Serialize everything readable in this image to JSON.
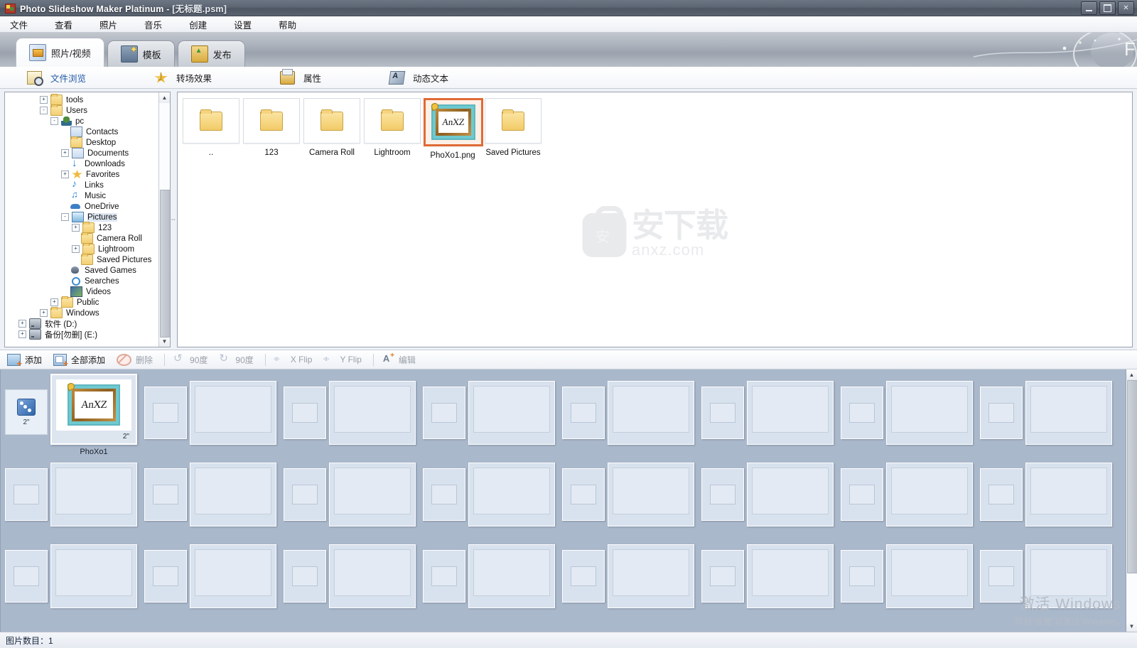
{
  "window": {
    "title_app": "Photo Slideshow Maker Platinum",
    "title_sep": " - ",
    "title_doc": "[无标题.psm]",
    "controls": {
      "minimize": "–",
      "maximize": "□",
      "close": "✕"
    }
  },
  "menu": {
    "items": [
      "文件",
      "查看",
      "照片",
      "音乐",
      "创建",
      "设置",
      "帮助"
    ]
  },
  "tabs": [
    {
      "label": "照片/视频",
      "icon": "photo-video-icon",
      "active": true
    },
    {
      "label": "模板",
      "icon": "template-icon",
      "active": false
    },
    {
      "label": "发布",
      "icon": "publish-icon",
      "active": false
    }
  ],
  "subtoolbar": [
    {
      "label": "文件浏览",
      "icon": "file-browse-icon",
      "active": true
    },
    {
      "label": "转场效果",
      "icon": "transition-star-icon",
      "active": false
    },
    {
      "label": "属性",
      "icon": "properties-icon",
      "active": false
    },
    {
      "label": "动态文本",
      "icon": "dynamic-text-icon",
      "active": false
    }
  ],
  "tree": {
    "nodes": [
      {
        "label": "tools",
        "indent": 3,
        "expander": "+",
        "icon": "folder-icon"
      },
      {
        "label": "Users",
        "indent": 3,
        "expander": "-",
        "icon": "folder-icon"
      },
      {
        "label": "pc",
        "indent": 4,
        "expander": "-",
        "icon": "user-icon"
      },
      {
        "label": "Contacts",
        "indent": 5,
        "expander": "",
        "icon": "contacts-icon"
      },
      {
        "label": "Desktop",
        "indent": 5,
        "expander": "",
        "icon": "folder-icon"
      },
      {
        "label": "Documents",
        "indent": 5,
        "expander": "+",
        "icon": "documents-icon"
      },
      {
        "label": "Downloads",
        "indent": 5,
        "expander": "",
        "icon": "downloads-icon"
      },
      {
        "label": "Favorites",
        "indent": 5,
        "expander": "+",
        "icon": "favorites-star-icon"
      },
      {
        "label": "Links",
        "indent": 5,
        "expander": "",
        "icon": "links-icon"
      },
      {
        "label": "Music",
        "indent": 5,
        "expander": "",
        "icon": "music-icon"
      },
      {
        "label": "OneDrive",
        "indent": 5,
        "expander": "",
        "icon": "onedrive-cloud-icon"
      },
      {
        "label": "Pictures",
        "indent": 5,
        "expander": "-",
        "icon": "pictures-icon",
        "selected": true
      },
      {
        "label": "123",
        "indent": 6,
        "expander": "+",
        "icon": "folder-icon"
      },
      {
        "label": "Camera Roll",
        "indent": 6,
        "expander": "",
        "icon": "folder-icon"
      },
      {
        "label": "Lightroom",
        "indent": 6,
        "expander": "+",
        "icon": "folder-icon"
      },
      {
        "label": "Saved Pictures",
        "indent": 6,
        "expander": "",
        "icon": "folder-icon"
      },
      {
        "label": "Saved Games",
        "indent": 5,
        "expander": "",
        "icon": "saved-games-icon"
      },
      {
        "label": "Searches",
        "indent": 5,
        "expander": "",
        "icon": "searches-icon"
      },
      {
        "label": "Videos",
        "indent": 5,
        "expander": "",
        "icon": "videos-icon"
      },
      {
        "label": "Public",
        "indent": 4,
        "expander": "+",
        "icon": "folder-icon"
      },
      {
        "label": "Windows",
        "indent": 3,
        "expander": "+",
        "icon": "folder-icon"
      },
      {
        "label": "软件 (D:)",
        "indent": 1,
        "expander": "+",
        "icon": "drive-icon"
      },
      {
        "label": "备份[勿删] (E:)",
        "indent": 1,
        "expander": "+",
        "icon": "drive-icon"
      }
    ]
  },
  "filebrowser": {
    "items": [
      {
        "name": "..",
        "type": "folder",
        "selected": false
      },
      {
        "name": "123",
        "type": "folder",
        "selected": false
      },
      {
        "name": "Camera Roll",
        "type": "folder",
        "selected": false
      },
      {
        "name": "Lightroom",
        "type": "folder",
        "selected": false
      },
      {
        "name": "PhoXo1.png",
        "type": "image",
        "selected": true,
        "art_text": "AnXZ"
      },
      {
        "name": "Saved Pictures",
        "type": "folder",
        "selected": false
      }
    ]
  },
  "watermark": {
    "logo_char": "安",
    "text": "安下载",
    "sub": "anxz.com"
  },
  "storytoolbar": {
    "buttons": [
      {
        "label": "添加",
        "icon": "add-icon",
        "disabled": false
      },
      {
        "label": "全部添加",
        "icon": "add-all-icon",
        "disabled": false
      },
      {
        "label": "删除",
        "icon": "delete-icon",
        "disabled": true
      },
      {
        "label": "90度",
        "icon": "rotate-left-icon",
        "disabled": true
      },
      {
        "label": "90度",
        "icon": "rotate-right-icon",
        "disabled": true
      },
      {
        "label": "X Flip",
        "icon": "flip-x-icon",
        "disabled": true
      },
      {
        "label": "Y Flip",
        "icon": "flip-y-icon",
        "disabled": true
      },
      {
        "label": "编辑",
        "icon": "edit-text-icon",
        "disabled": true
      }
    ]
  },
  "storyboard": {
    "first_transition": {
      "duration": "2\"",
      "icon": "transition-dice-icon"
    },
    "selected_slide": {
      "duration": "2\"",
      "caption": "PhoXo1",
      "art_text": "AnXZ"
    },
    "empty_transition_duration": "",
    "rows": 3,
    "cells_per_row": 8
  },
  "statusbar": {
    "text": "图片数目：1"
  },
  "activation": {
    "line1": "激活 Windows",
    "line2": "转到“设置”以激活 Windows。"
  }
}
